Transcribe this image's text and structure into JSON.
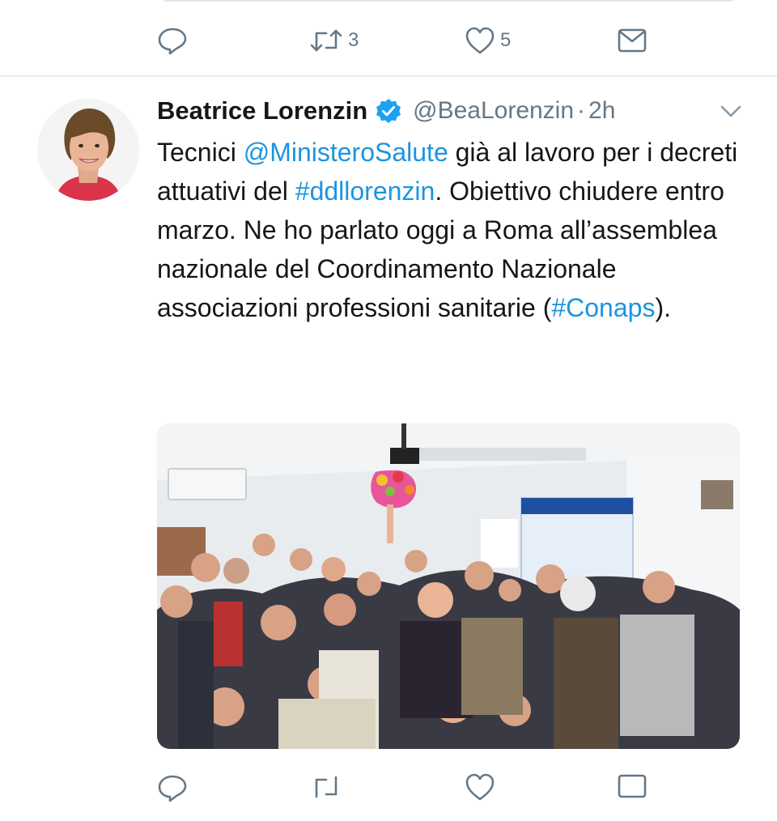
{
  "previous_tweet": {
    "actions": {
      "reply_count": "",
      "retweet_count": "3",
      "like_count": "5"
    }
  },
  "tweet": {
    "author": {
      "display_name": "Beatrice Lorenzin",
      "handle": "@BeaLorenzin",
      "verified": true
    },
    "separator_dot": "·",
    "timestamp": "2h",
    "text_parts": {
      "p1": "Tecnici ",
      "mention": "@MinisteroSalute",
      "p2": " già al lavoro per i decreti attuativi del ",
      "hashtag1": "#ddllorenzin",
      "p3": ". Obiettivo chiudere entro marzo. Ne ho parlato oggi a Roma all’assemblea nazionale del Coordinamento Nazionale associazioni professioni sanitarie (",
      "hashtag2": "#Conaps",
      "p4": ")."
    }
  },
  "icons": {
    "reply": "reply-icon",
    "retweet": "retweet-icon",
    "like": "heart-icon",
    "dm": "mail-icon",
    "verified": "verified-badge-icon",
    "caret": "chevron-down-icon"
  },
  "colors": {
    "link": "#1b95e0",
    "verified": "#1da1f2",
    "secondary_text": "#657786",
    "divider": "#e6ecf0"
  }
}
